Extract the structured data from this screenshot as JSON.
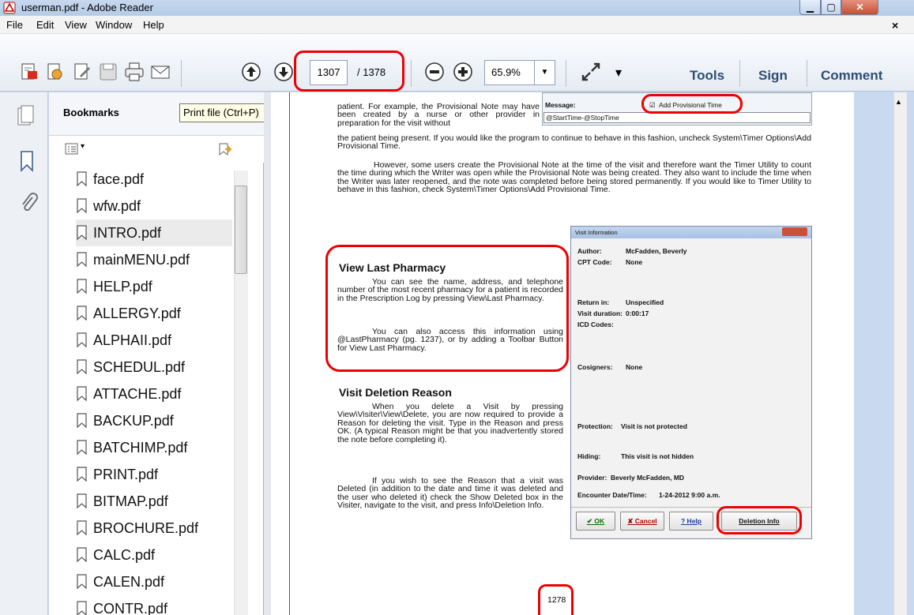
{
  "window": {
    "title": "userman.pdf - Adobe Reader",
    "min_glyph": "▁",
    "max_glyph": "▢",
    "close_glyph": "✕"
  },
  "menu": {
    "items": [
      "File",
      "Edit",
      "View",
      "Window",
      "Help"
    ],
    "close_glyph": "×"
  },
  "toolbar": {
    "page_current": "1307",
    "page_total": "/ 1378",
    "zoom": "65.9%",
    "zoom_arrow": "▼",
    "overflow_glyph": "▾",
    "tools_label": "Tools",
    "sign_label": "Sign",
    "comment_label": "Comment",
    "tooltip": "Print file (Ctrl+P)"
  },
  "bookmarks": {
    "title": "Bookmarks",
    "options_caret": "▾",
    "items": [
      "face.pdf",
      "wfw.pdf",
      "INTRO.pdf",
      "mainMENU.pdf",
      "HELP.pdf",
      "ALLERGY.pdf",
      "ALPHAII.pdf",
      "SCHEDUL.pdf",
      "ATTACHE.pdf",
      "BACKUP.pdf",
      "BATCHIMP.pdf",
      "PRINT.pdf",
      "BITMAP.pdf",
      "BROCHURE.pdf",
      "CALC.pdf",
      "CALEN.pdf",
      "CONTR.pdf"
    ],
    "selected_index": 2
  },
  "document": {
    "intro_lines": "patient. For example, the Provisional Note may have been created by a nurse or other provider in preparation for the visit without",
    "para1_cont": "the patient being present. If you would like the program to continue to behave in this fashion, uncheck System\\Timer Options\\Add Provisional Time.",
    "para2": "However, some users create the Provisional Note at the time of the visit and therefore want the Timer Utility to count the time during which the Writer was open while the Provisional Note was being created.  They also want to include the time when the Writer was later reopened, and the note was completed before being stored permanently. If you would like to Timer Utility to behave in this fashion, check System\\Timer Options\\Add Provisional Time.",
    "section1_heading": "View Last Pharmacy",
    "section1_p1": "You can see the name, address, and telephone number of the most recent pharmacy for a patient is recorded in the Prescription Log by pressing View\\Last Pharmacy.",
    "section1_p2": "You can also access this information using @LastPharmacy (pg. 1237), or by adding a Toolbar Button for View Last Pharmacy.",
    "section2_heading": "Visit Deletion Reason",
    "section2_p1": "When you delete a Visit by pressing View\\Visiter\\View\\Delete, you are now required to provide a Reason for deleting the visit. Type in the Reason and press OK. (A typical Reason might be that you inadvertently stored the note before completing it).",
    "section2_p2": "If you wish to see the Reason that a visit was Deleted (in addition to the date and time it was deleted and the user who deleted it) check the Show Deleted box in the Visiter, navigate to the visit, and press Info\\Deletion Info.",
    "page_number": "1278"
  },
  "shot1": {
    "message_label": "Message:",
    "checkbox_label": "Add Provisional Time",
    "checkbox_mark": "☑",
    "field_value": "@StartTime-@StopTime"
  },
  "shot2": {
    "title": "Visit Information",
    "author_label": "Author:",
    "author_value": "McFadden, Beverly",
    "cpt_label": "CPT Code:",
    "cpt_value": "None",
    "return_label": "Return in:",
    "return_value": "Unspecified",
    "duration_label": "Visit duration:",
    "duration_value": "0:00:17",
    "icd_label": "ICD Codes:",
    "cosigners_label": "Cosigners:",
    "cosigners_value": "None",
    "protection_label": "Protection:",
    "protection_value": "Visit is not protected",
    "hiding_label": "Hiding:",
    "hiding_value": "This visit is not hidden",
    "provider_label": "Provider:",
    "provider_value": "Beverly McFadden, MD",
    "encounter_label": "Encounter Date/Time:",
    "encounter_value": "1-24-2012 9:00 a.m.",
    "ok": "✔ OK",
    "cancel": "✘ Cancel",
    "help": "? Help",
    "deletion": "Deletion Info"
  },
  "colors": {
    "accent_red": "#e00000",
    "tools_text": "#2d4d72"
  }
}
